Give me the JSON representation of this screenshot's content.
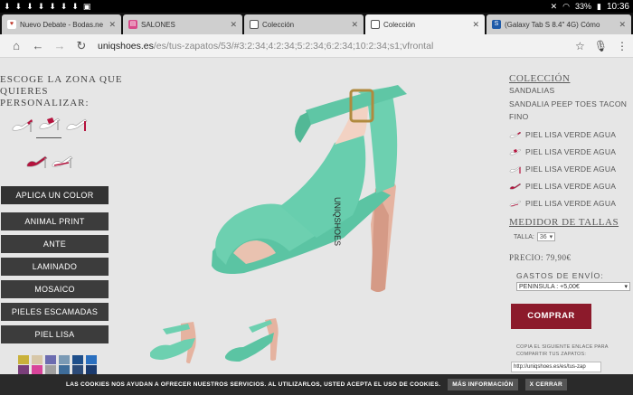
{
  "statusbar": {
    "time": "10:36",
    "battery": "33%",
    "icons": [
      "download-icon",
      "download-icon",
      "download-icon",
      "download-icon",
      "download-icon",
      "download-icon",
      "download-icon",
      "photo-icon"
    ]
  },
  "tabs": [
    {
      "title": "Nuevo Debate - Bodas.net",
      "favicon_color": "#c0392b",
      "favicon_char": "♥"
    },
    {
      "title": "SALONES",
      "favicon_color": "#c0395b",
      "favicon_char": "▤"
    },
    {
      "title": "Colección",
      "favicon_color": "#333",
      "favicon_char": "■"
    },
    {
      "title": "Colección",
      "favicon_color": "#333",
      "favicon_char": "■",
      "active": true
    },
    {
      "title": "(Galaxy Tab S 8.4\" 4G) Cómo",
      "favicon_color": "#1e5aa8",
      "favicon_char": "S"
    }
  ],
  "address": {
    "host": "uniqshoes.es",
    "path": "/es/tus-zapatos/53/#3:2:34;4:2:34;5:2:34;6:2:34;10:2:34;s1;vfrontal"
  },
  "left": {
    "zone_title_line1": "ESCOGE LA ZONA QUE",
    "zone_title_line2": "QUIERES PERSONALIZAR:",
    "apply_label": "APLICA UN COLOR",
    "options": [
      "ANIMAL PRINT",
      "ANTE",
      "LAMINADO",
      "MOSAICO",
      "PIELES ESCAMADAS",
      "PIEL LISA"
    ],
    "swatches": [
      "#c9b13a",
      "#d7c7a8",
      "#6c6cb0",
      "#7a9ab5",
      "#1e4f8b",
      "#2a6fbf",
      "#7a3f7a",
      "#d8449a",
      "#a0a0a0",
      "#3e6d9a",
      "#2c4b78",
      "#1b3b6f"
    ]
  },
  "center": {
    "brand_text": "UNIQSHOES",
    "shoe_color": "#6dd0b0"
  },
  "right": {
    "coleccion_title": "COLECCIÓN",
    "category": "SANDALIAS",
    "model": "SANDALIA PEEP TOES TACON FINO",
    "materials": [
      "PIEL LISA VERDE AGUA",
      "PIEL LISA VERDE AGUA",
      "PIEL LISA VERDE AGUA",
      "PIEL LISA VERDE AGUA",
      "PIEL LISA VERDE AGUA"
    ],
    "medidor_title": "MEDIDOR DE TALLAS",
    "talla_label": "TALLA:",
    "talla_value": "36",
    "price_label": "PRECIO:",
    "price_value": "79,90€",
    "gastos_label": "GASTOS DE ENVÍO:",
    "gastos_value": "PENINSULA : +5,00€",
    "comprar_label": "COMPRAR",
    "copia_line1": "COPIA EL SIGUIENTE ENLACE PARA",
    "copia_line2": "COMPARTIR TUS ZAPATOS:",
    "share_link": "http://uniqshoes.es/es/tus-zap"
  },
  "cookie": {
    "text": "LAS COOKIES NOS AYUDAN A OFRECER NUESTROS SERVICIOS. AL UTILIZARLOS, USTED ACEPTA EL USO DE COOKIES.",
    "more_label": "MÁS INFORMACIÓN",
    "close_label": "X CERRAR"
  }
}
